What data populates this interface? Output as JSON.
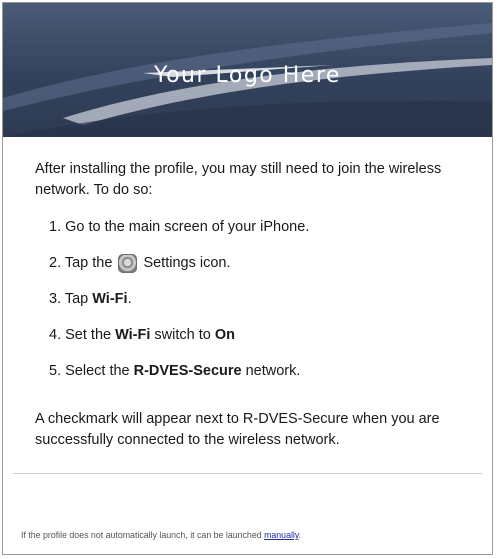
{
  "banner": {
    "logo_text": "Your Logo Here"
  },
  "instructions": {
    "intro": "After installing the profile, you may still need to join the wireless network. To do so:",
    "step1": "1. Go to the main screen of your iPhone.",
    "step2_prefix": "2. Tap the",
    "step2_suffix": "Settings icon.",
    "step3_prefix": "3. Tap",
    "step3_bold": "Wi-Fi",
    "step3_suffix": ".",
    "step4_prefix": "4. Set the",
    "step4_bold1": "Wi-Fi",
    "step4_middle": "switch to",
    "step4_bold2": "On",
    "step5_prefix": "5. Select the",
    "step5_bold": "R-DVES-Secure",
    "step5_suffix": "network.",
    "closing": "A checkmark will appear next to R-DVES-Secure when you are successfully connected to the wireless network."
  },
  "footer": {
    "text": "If the profile does not automatically launch, it can be launched",
    "link_label": "manually",
    "end": "."
  },
  "icons": {
    "settings": "settings-gear-icon"
  },
  "colors": {
    "banner_dark": "#33425c",
    "link": "#1a2ea0"
  }
}
